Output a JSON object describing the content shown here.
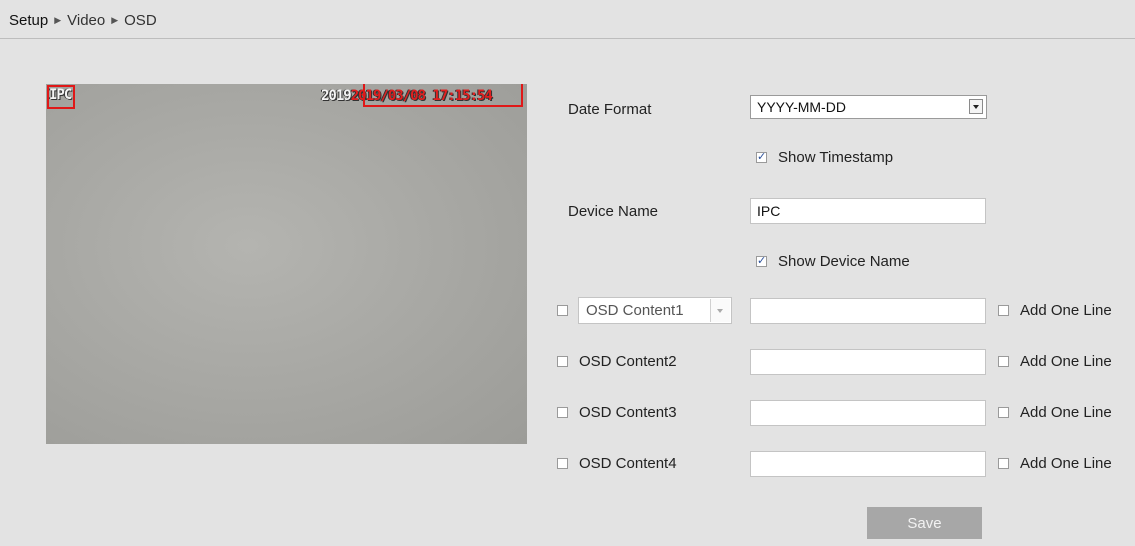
{
  "breadcrumb": {
    "root": "Setup",
    "level2": "Video",
    "level3": "OSD",
    "separator": "▶"
  },
  "preview": {
    "device_name_overlay": "IPC",
    "timestamp_overlay_prefix": "2019",
    "timestamp_overlay": "2019/03/08 17:15:54"
  },
  "date_format": {
    "label": "Date Format",
    "value": "YYYY-MM-DD"
  },
  "show_timestamp": {
    "label": "Show Timestamp",
    "checked": true
  },
  "device_name": {
    "label": "Device Name",
    "value": "IPC"
  },
  "show_device_name": {
    "label": "Show Device Name",
    "checked": true
  },
  "osd_rows": [
    {
      "label": "OSD Content1",
      "value": "",
      "add_line_label": "Add One Line",
      "enabled": false
    },
    {
      "label": "OSD Content2",
      "value": "",
      "add_line_label": "Add One Line",
      "enabled": false
    },
    {
      "label": "OSD Content3",
      "value": "",
      "add_line_label": "Add One Line",
      "enabled": false
    },
    {
      "label": "OSD Content4",
      "value": "",
      "add_line_label": "Add One Line",
      "enabled": false
    }
  ],
  "save_label": "Save",
  "colors": {
    "background": "#e3e3e3",
    "osd_box": "#e01818",
    "save_button": "#a7a7a7"
  }
}
